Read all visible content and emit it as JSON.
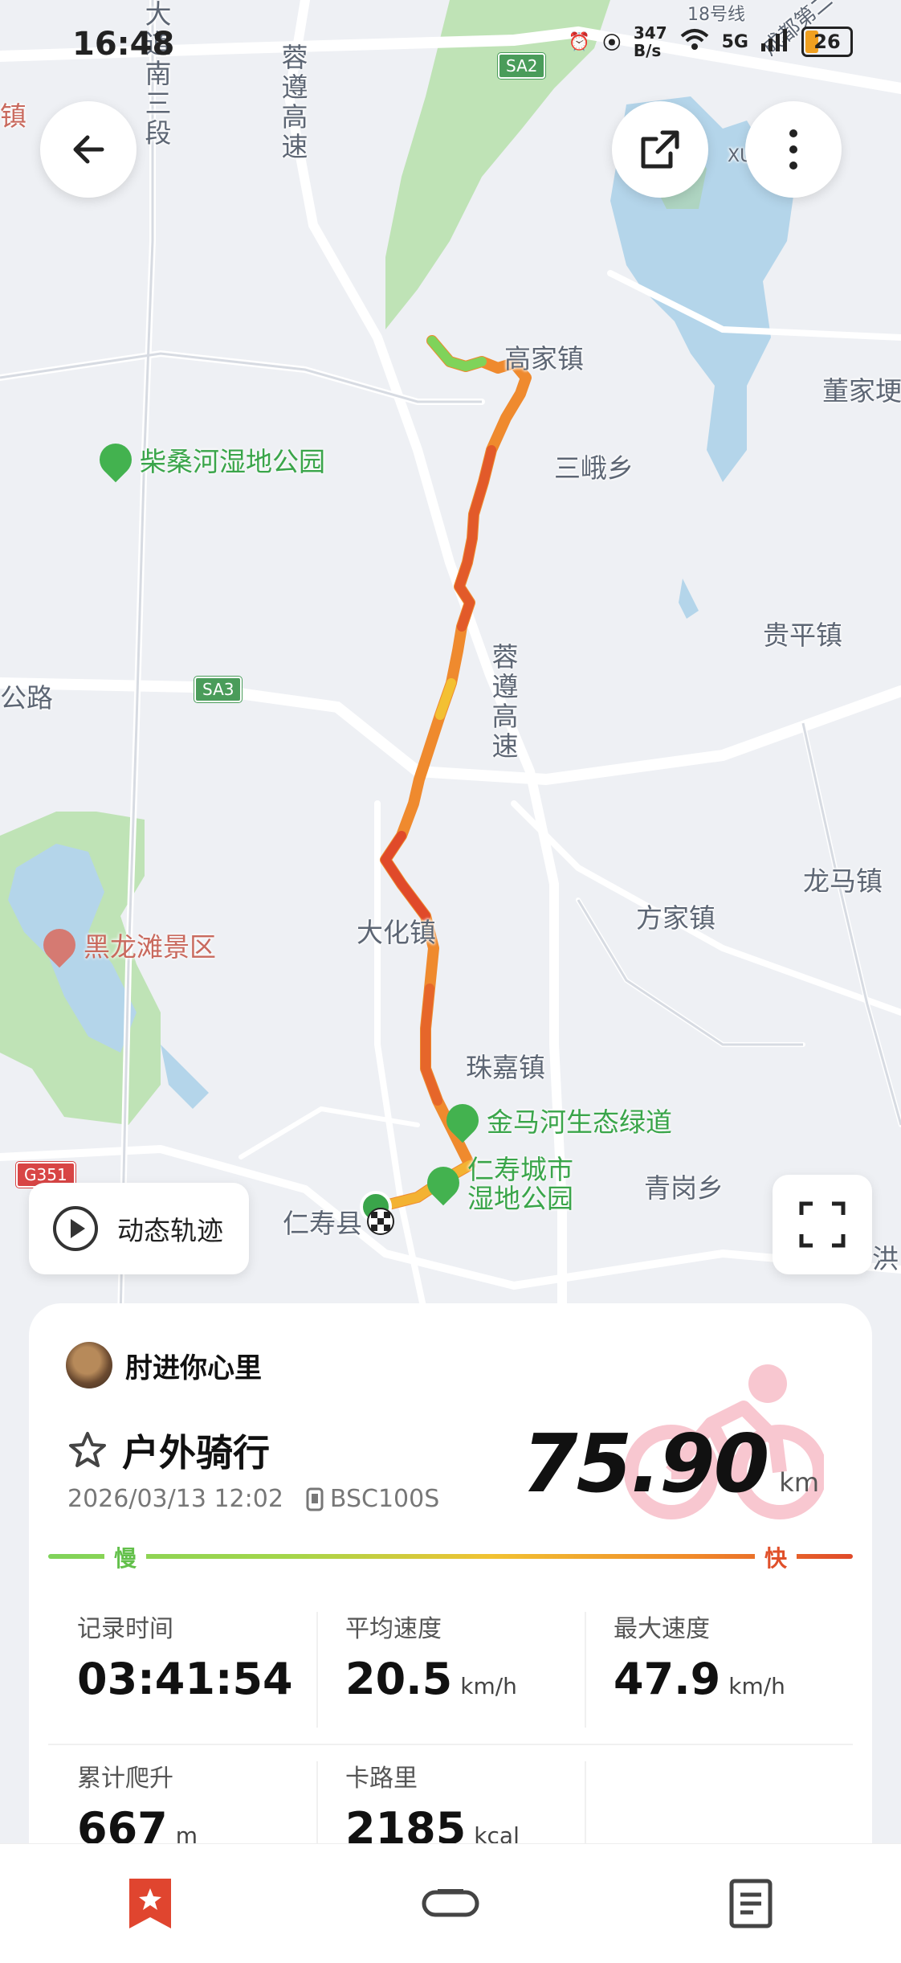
{
  "status_bar": {
    "time": "16:48",
    "net_speed_value": "347",
    "net_speed_unit": "B/s",
    "network": "5G",
    "battery": "26"
  },
  "map": {
    "labels": {
      "dahua_town": "大化镇",
      "gaojia_town": "高家镇",
      "sane_township": "三峨乡",
      "dongjia": "董家埂",
      "guiping_town": "贵平镇",
      "longma_town": "龙马镇",
      "fangjia_town": "方家镇",
      "zhujia_town": "珠嘉镇",
      "qinggang_township": "青岗乡",
      "renshou": "仁寿县",
      "rongzun_1": "蓉遵高速",
      "rongzun_2": "蓉遵高速",
      "danan_road": "大道南三段",
      "road_left": "公路",
      "town_left": "镇",
      "hong": "洪",
      "cheng_di": "成都第二",
      "xu": "XU",
      "line18": "18号线"
    },
    "pois": {
      "chaisang": "柴桑河湿地公园",
      "heilongtan": "黑龙滩景区",
      "jinmahe": "金马河生态绿道",
      "renshou_wetland_1": "仁寿城市",
      "renshou_wetland_2": "湿地公园"
    },
    "shields": {
      "sa2": "SA2",
      "sa3": "SA3",
      "g351": "G351"
    },
    "route_colors": {
      "slow": "#7fd35a",
      "mid": "#f1a22a",
      "fast": "#e04a2a"
    }
  },
  "buttons": {
    "replay": "动态轨迹"
  },
  "icons": {
    "back": "arrow-left-icon",
    "share": "share-icon",
    "more": "more-vertical-icon",
    "play": "play-icon",
    "fullscreen": "fullscreen-icon"
  },
  "activity": {
    "username": "肘进你心里",
    "type": "户外骑行",
    "datetime": "2026/03/13 12:02",
    "device": "BSC100S",
    "distance": "75.90",
    "distance_unit": "km",
    "legend_slow": "慢",
    "legend_fast": "快",
    "stats": {
      "duration": {
        "label": "记录时间",
        "value": "03:41:54",
        "unit": ""
      },
      "avg_speed": {
        "label": "平均速度",
        "value": "20.5",
        "unit": "km/h"
      },
      "max_speed": {
        "label": "最大速度",
        "value": "47.9",
        "unit": "km/h"
      },
      "ascent": {
        "label": "累计爬升",
        "value": "667",
        "unit": "m"
      },
      "calories": {
        "label": "卡路里",
        "value": "2185",
        "unit": "kcal"
      }
    }
  },
  "nav": {
    "items": [
      "bookmark-icon",
      "device-icon",
      "document-icon"
    ]
  }
}
